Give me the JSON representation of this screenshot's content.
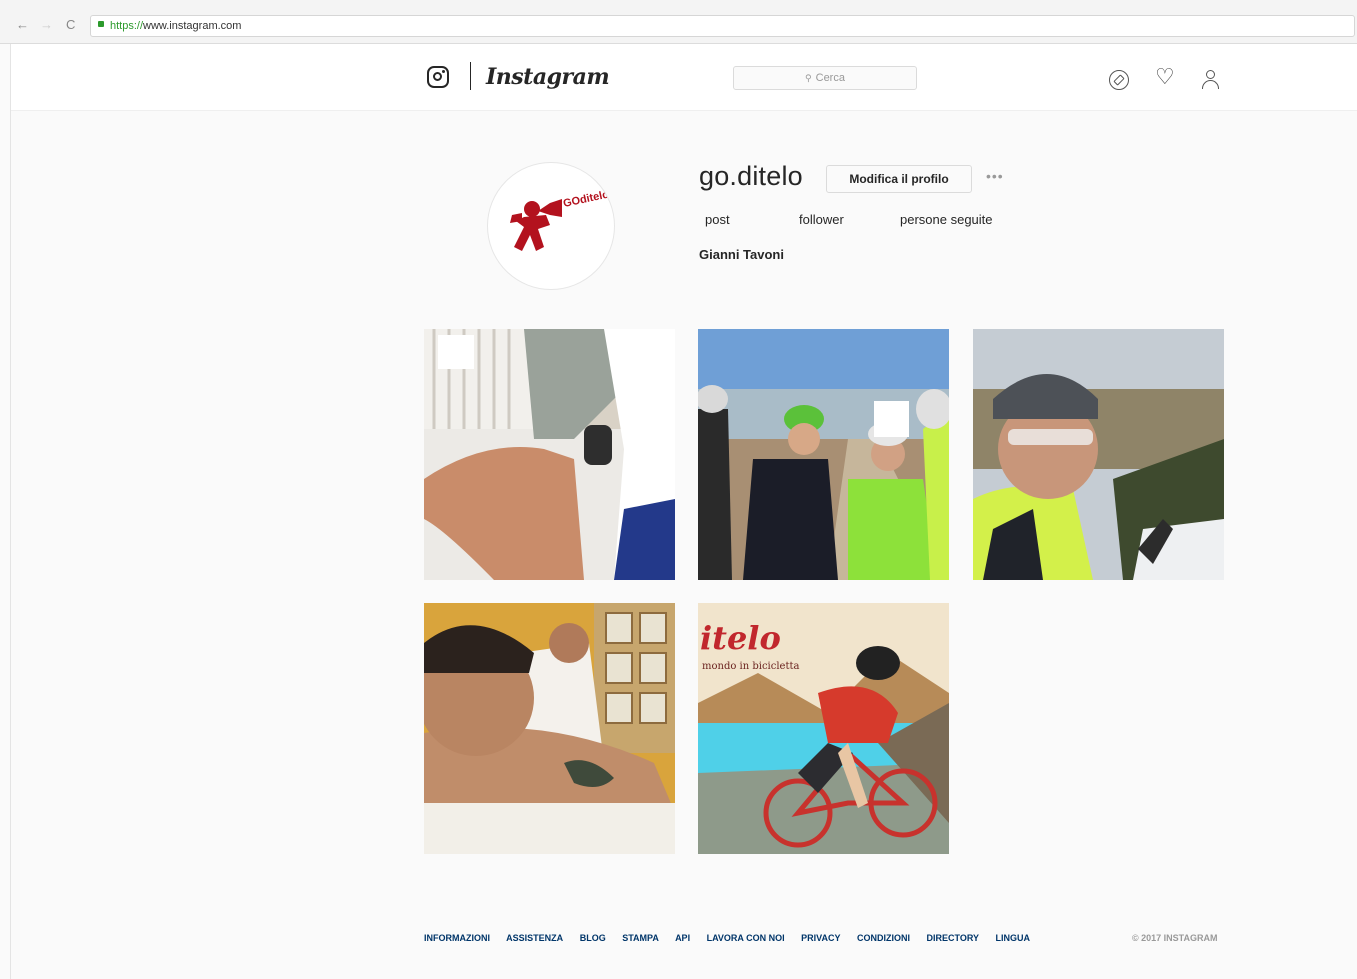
{
  "browser": {
    "back_icon": "←",
    "forward_icon": "→",
    "reload_icon": "C",
    "url_scheme": "https://",
    "url_host": "www.instagram.com"
  },
  "header": {
    "wordmark": "Instagram",
    "search_placeholder": "Cerca",
    "search_icon": "⚲",
    "icons": [
      "compass-icon",
      "heart-icon",
      "person-icon"
    ]
  },
  "profile": {
    "username": "go.ditelo",
    "edit_button": "Modifica il profilo",
    "more_label": "•••",
    "stats": {
      "posts_label": "post",
      "followers_label": "follower",
      "following_label": "persone seguite"
    },
    "full_name": "Gianni Tavoni",
    "avatar_text": "GOditelo"
  },
  "posts": [
    {
      "subject": "massage-leg"
    },
    {
      "subject": "cyclists-group"
    },
    {
      "subject": "cyclist-selfie"
    },
    {
      "subject": "man-massage"
    },
    {
      "subject": "illustration-cyclist",
      "caption_title": "itelo",
      "caption_sub": "mondo in bicicletta"
    }
  ],
  "footer": {
    "links": [
      "INFORMAZIONI",
      "ASSISTENZA",
      "BLOG",
      "STAMPA",
      "API",
      "LAVORA CON NOI",
      "PRIVACY",
      "CONDIZIONI",
      "DIRECTORY",
      "LINGUA"
    ],
    "copyright": "© 2017 INSTAGRAM"
  }
}
